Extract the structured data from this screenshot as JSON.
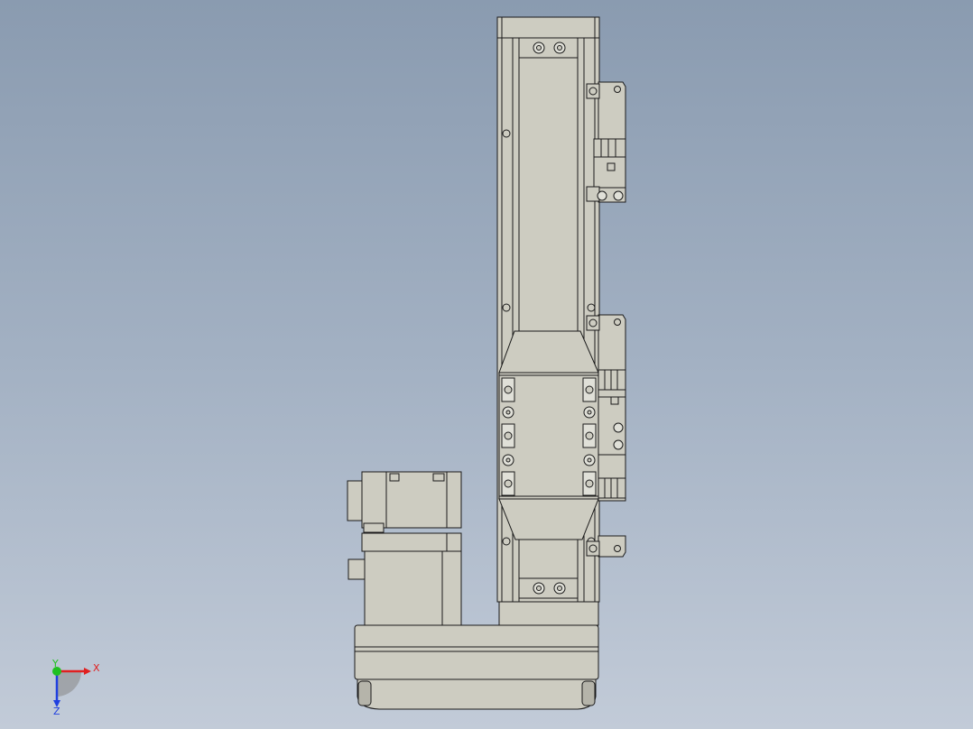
{
  "colors": {
    "background_top": "#8a9bb0",
    "background_bottom": "#c2cbd8",
    "part_fill": "#cdccc1",
    "part_shade": "#b5b4aa",
    "edge": "#1a1a1a",
    "axis_x": "#e02020",
    "axis_y": "#20c020",
    "axis_z": "#2040e0"
  },
  "triad": {
    "x_label": "X",
    "y_label": "Y",
    "z_label": "Z"
  }
}
